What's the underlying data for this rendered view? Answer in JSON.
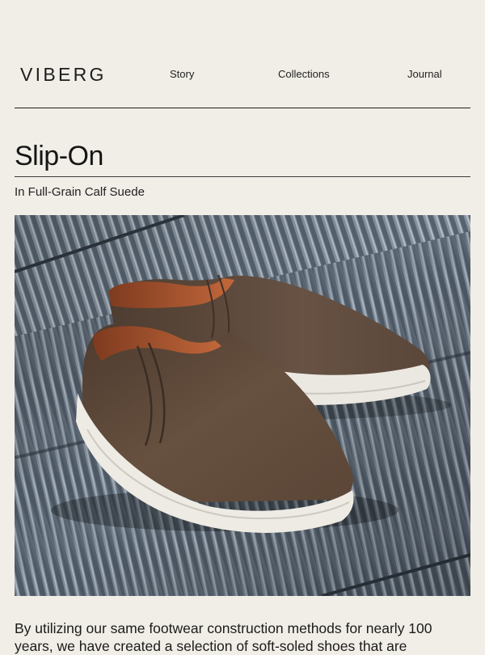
{
  "header": {
    "logo": "VIBERG",
    "nav": {
      "story": "Story",
      "collections": "Collections",
      "journal": "Journal"
    }
  },
  "product": {
    "title": "Slip-On",
    "subtitle": "In Full-Grain Calf Suede",
    "image_alt": "Brown suede slip-on shoes with white soles on a ribbed metal floor",
    "description": "By utilizing our same footwear construction methods for nearly 100 years, we have created a selection of soft-soled shoes that are"
  },
  "colors": {
    "background": "#f1eee7",
    "text": "#1a1a1a",
    "suede": "#5e4a3c",
    "lining": "#b65a33",
    "sole": "#eeebe4"
  }
}
